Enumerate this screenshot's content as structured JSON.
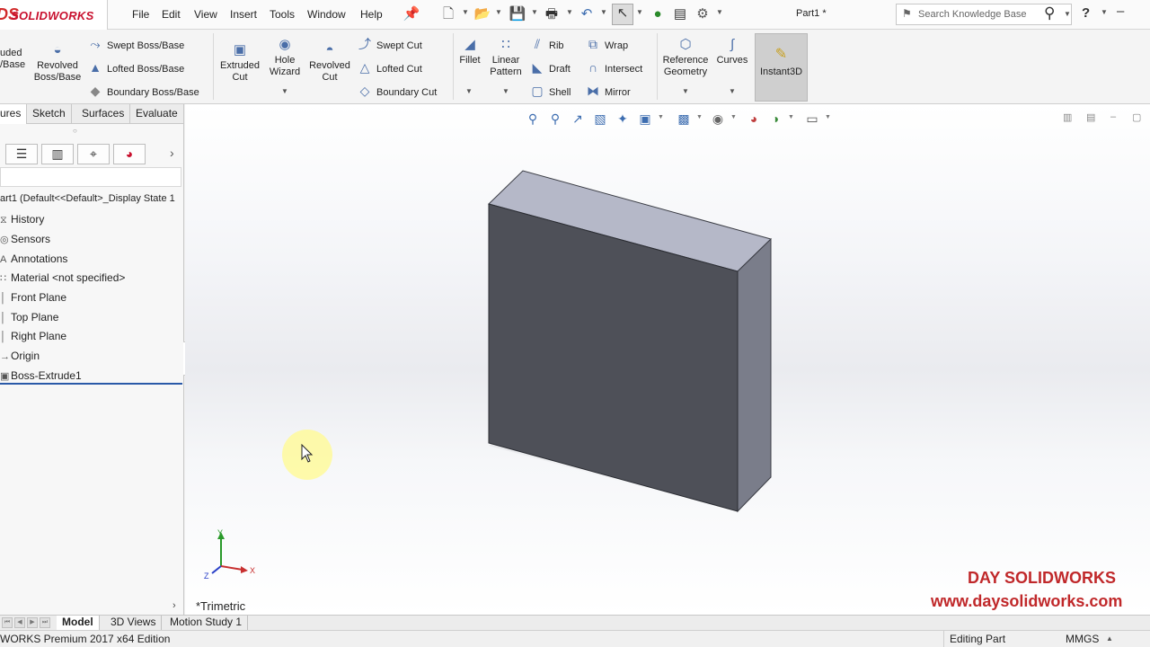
{
  "app": {
    "logo_text": "SOLIDWORKS",
    "logo_mark": "DS"
  },
  "menu": [
    "File",
    "Edit",
    "View",
    "Insert",
    "Tools",
    "Window",
    "Help"
  ],
  "document_title": "Part1 *",
  "search": {
    "placeholder": "Search Knowledge Base"
  },
  "help_glyph": "?",
  "commands": {
    "extruded_boss": "uded\n/Base",
    "revolved_boss": "Revolved\nBoss/Base",
    "swept_boss": "Swept Boss/Base",
    "lofted_boss": "Lofted Boss/Base",
    "boundary_boss": "Boundary Boss/Base",
    "extruded_cut": "Extruded\nCut",
    "hole_wizard": "Hole\nWizard",
    "revolved_cut": "Revolved\nCut",
    "swept_cut": "Swept Cut",
    "lofted_cut": "Lofted Cut",
    "boundary_cut": "Boundary Cut",
    "fillet": "Fillet",
    "linear_pattern": "Linear\nPattern",
    "rib": "Rib",
    "draft": "Draft",
    "shell": "Shell",
    "wrap": "Wrap",
    "intersect": "Intersect",
    "mirror": "Mirror",
    "reference_geometry": "Reference\nGeometry",
    "curves": "Curves",
    "instant3d": "Instant3D"
  },
  "cm_tabs": [
    "ures",
    "Sketch",
    "Surfaces",
    "Evaluate"
  ],
  "tree": {
    "root": "art1  (Default<<Default>_Display State 1",
    "items": [
      {
        "label": "History",
        "icon": "history-icon"
      },
      {
        "label": "Sensors",
        "icon": "sensors-icon"
      },
      {
        "label": "Annotations",
        "icon": "annotations-icon"
      },
      {
        "label": "Material <not specified>",
        "icon": "material-icon"
      },
      {
        "label": "Front Plane",
        "icon": "plane-icon"
      },
      {
        "label": "Top Plane",
        "icon": "plane-icon"
      },
      {
        "label": "Right Plane",
        "icon": "plane-icon"
      },
      {
        "label": "Origin",
        "icon": "origin-icon"
      },
      {
        "label": "Boss-Extrude1",
        "icon": "extrude-icon"
      }
    ]
  },
  "viewport": {
    "view_name": "*Trimetric",
    "axis_x": "X",
    "axis_y": "Y",
    "axis_z": "Z",
    "watermark_line1": "DAY SOLIDWORKS",
    "watermark_line2": "www.daysolidworks.com"
  },
  "bottom_tabs": [
    "Model",
    "3D Views",
    "Motion Study 1"
  ],
  "status": {
    "edition": "WORKS Premium 2017 x64 Edition",
    "mode": "Editing Part",
    "units": "MMGS"
  },
  "colors": {
    "front_face": "#4e5058",
    "top_face": "#b5b8c8",
    "side_face": "#7a7d8a",
    "brand_red": "#c8102e"
  }
}
